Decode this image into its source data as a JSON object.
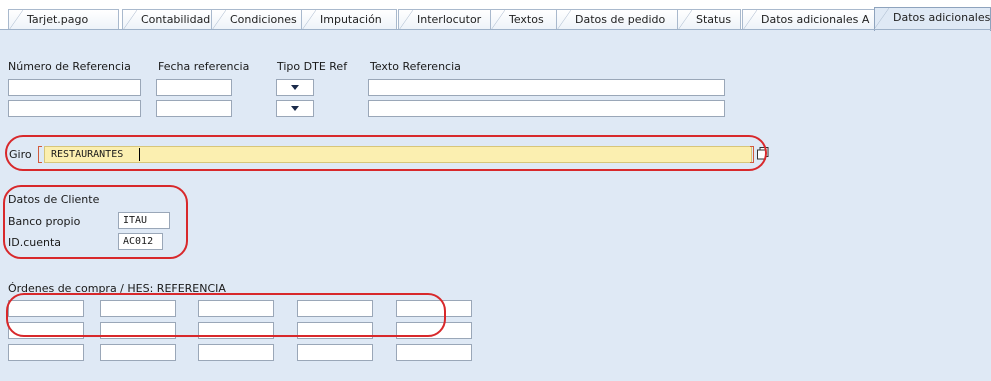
{
  "tabs": [
    {
      "label": "Tarjet.pago"
    },
    {
      "label": "Contabilidad"
    },
    {
      "label": "Condiciones"
    },
    {
      "label": "Imputación"
    },
    {
      "label": "Interlocutor"
    },
    {
      "label": "Textos"
    },
    {
      "label": "Datos de pedido"
    },
    {
      "label": "Status"
    },
    {
      "label": "Datos adicionales A"
    },
    {
      "label": "Datos adicionales I",
      "active": true
    }
  ],
  "referencia": {
    "numero_label": "Número de Referencia",
    "fecha_label": "Fecha referencia",
    "tipo_label": "Tipo DTE Ref",
    "texto_label": "Texto Referencia",
    "rows": [
      {
        "numero": "",
        "fecha": "",
        "tipo": "",
        "texto": ""
      },
      {
        "numero": "",
        "fecha": "",
        "tipo": "",
        "texto": ""
      }
    ]
  },
  "giro": {
    "label": "Giro",
    "value": "RESTAURANTES"
  },
  "cliente": {
    "section_label": "Datos de Cliente",
    "banco_label": "Banco propio",
    "banco_value": "ITAU",
    "cuenta_label": "ID.cuenta",
    "cuenta_value": "AC012"
  },
  "ordenes": {
    "label": "Órdenes de compra / HES: REFERENCIA",
    "rows": [
      [
        "",
        "",
        "",
        "",
        ""
      ],
      [
        "",
        "",
        "",
        "",
        ""
      ],
      [
        "",
        "",
        "",
        "",
        ""
      ]
    ]
  },
  "colors": {
    "background": "#dfe9f5",
    "highlight_field": "#fbefb0",
    "annotation_red": "#d8282b"
  }
}
